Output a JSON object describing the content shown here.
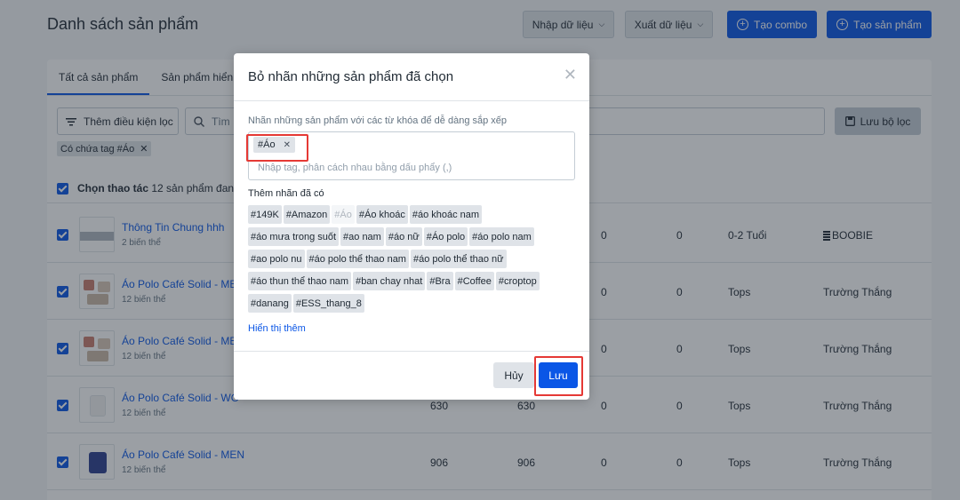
{
  "header": {
    "title": "Danh sách sản phẩm",
    "import_label": "Nhập dữ liệu",
    "export_label": "Xuất dữ liệu",
    "create_combo_label": "Tạo combo",
    "create_product_label": "Tạo sản phẩm"
  },
  "tabs": [
    "Tất cả sản phẩm",
    "Sản phẩm hiển t"
  ],
  "filters": {
    "add_condition_label": "Thêm điều kiện lọc",
    "search_placeholder": "Tìm",
    "save_filter_label": "Lưu bộ lọc",
    "active_chip": "Có chứa tag #Áo"
  },
  "bulk": {
    "label": "Chọn thao tác",
    "count_text": "12 sản phẩm đang"
  },
  "products": [
    {
      "name": "Thông Tin Chung hhh",
      "variants": "2 biến thể",
      "stock": "",
      "available": "",
      "c3": "0",
      "c4": "0",
      "type": "0-2 Tuổi",
      "vendor": "BOOBIE"
    },
    {
      "name": "Áo Polo Café Solid - ME",
      "variants": "12 biến thể",
      "stock": "",
      "available": "",
      "c3": "0",
      "c4": "0",
      "type": "Tops",
      "vendor": "Trường Thắng"
    },
    {
      "name": "Áo Polo Café Solid - ME",
      "variants": "12 biến thể",
      "stock": "",
      "available": "",
      "c3": "0",
      "c4": "0",
      "type": "Tops",
      "vendor": "Trường Thắng"
    },
    {
      "name": "Áo Polo Café Solid - WO",
      "variants": "12 biến thể",
      "stock": "630",
      "available": "630",
      "c3": "0",
      "c4": "0",
      "type": "Tops",
      "vendor": "Trường Thắng"
    },
    {
      "name": "Áo Polo Café Solid - MEN",
      "variants": "12 biến thể",
      "stock": "906",
      "available": "906",
      "c3": "0",
      "c4": "0",
      "type": "Tops",
      "vendor": "Trường Thắng"
    }
  ],
  "modal": {
    "title": "Bỏ nhãn những sản phẩm đã chọn",
    "description": "Nhãn những sản phẩm với các từ khóa để dễ dàng sắp xếp",
    "selected_tag": "#Áo",
    "input_placeholder": "Nhập tag, phân cách nhau bằng dấu phẩy (,)",
    "existing_label": "Thêm nhãn đã có",
    "tag_rows": [
      [
        "#149K",
        "#Amazon",
        "#Áo",
        "#Áo khoác",
        "#áo khoác nam"
      ],
      [
        "#áo mưa trong suốt",
        "#ao nam",
        "#áo nữ",
        "#Áo polo",
        "#áo polo nam"
      ],
      [
        "#ao polo nu",
        "#áo polo thể thao nam",
        "#áo polo thể thao nữ"
      ],
      [
        "#áo thun thể thao nam",
        "#ban chay nhat",
        "#Bra",
        "#Coffee",
        "#croptop"
      ],
      [
        "#danang",
        "#ESS_thang_8"
      ]
    ],
    "show_more_label": "Hiển thị thêm",
    "cancel_label": "Hủy",
    "save_label": "Lưu"
  }
}
